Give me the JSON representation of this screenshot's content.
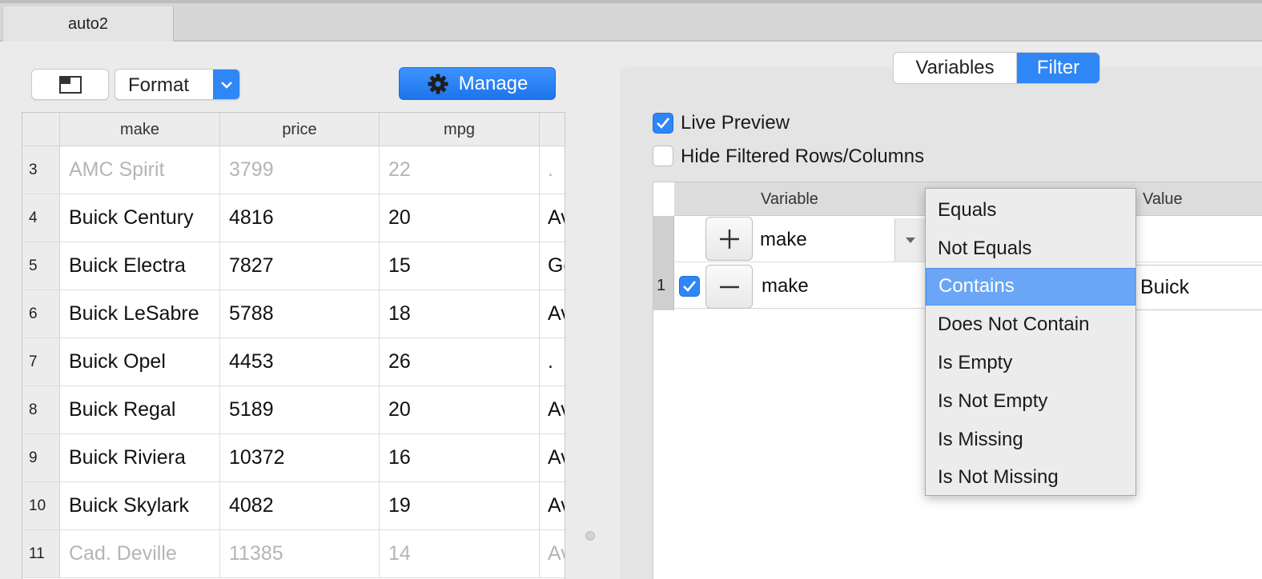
{
  "document_tab": {
    "label": "auto2"
  },
  "toolbar": {
    "format_label": "Format",
    "manage_label": "Manage"
  },
  "grid": {
    "columns": [
      "make",
      "price",
      "mpg",
      ""
    ],
    "rows": [
      {
        "num": "3",
        "make": "AMC Spirit",
        "price": "3799",
        "mpg": "22",
        "extra": ".",
        "dim": true
      },
      {
        "num": "4",
        "make": "Buick Century",
        "price": "4816",
        "mpg": "20",
        "extra": "Av",
        "dim": false
      },
      {
        "num": "5",
        "make": "Buick Electra",
        "price": "7827",
        "mpg": "15",
        "extra": "Go",
        "dim": false
      },
      {
        "num": "6",
        "make": "Buick LeSabre",
        "price": "5788",
        "mpg": "18",
        "extra": "Av",
        "dim": false
      },
      {
        "num": "7",
        "make": "Buick Opel",
        "price": "4453",
        "mpg": "26",
        "extra": ".",
        "dim": false
      },
      {
        "num": "8",
        "make": "Buick Regal",
        "price": "5189",
        "mpg": "20",
        "extra": "Av",
        "dim": false
      },
      {
        "num": "9",
        "make": "Buick Riviera",
        "price": "10372",
        "mpg": "16",
        "extra": "Av",
        "dim": false
      },
      {
        "num": "10",
        "make": "Buick Skylark",
        "price": "4082",
        "mpg": "19",
        "extra": "Av",
        "dim": false
      },
      {
        "num": "11",
        "make": "Cad. Deville",
        "price": "11385",
        "mpg": "14",
        "extra": "Av",
        "dim": true
      }
    ]
  },
  "panel": {
    "tabs": {
      "variables": "Variables",
      "filter": "Filter"
    },
    "live_preview": {
      "label": "Live Preview",
      "checked": true
    },
    "hide_filtered": {
      "label": "Hide Filtered Rows/Columns",
      "checked": false
    },
    "filter_table": {
      "headers": {
        "variable": "Variable",
        "value": "Value"
      },
      "add_row_variable": "make",
      "rule": {
        "index": "1",
        "enabled": true,
        "variable": "make",
        "value": "Buick"
      }
    }
  },
  "operator_menu": {
    "items": [
      "Equals",
      "Not Equals",
      "Contains",
      "Does Not Contain",
      "Is Empty",
      "Is Not Empty",
      "Is Missing",
      "Is Not Missing"
    ],
    "selected": "Contains"
  },
  "colors": {
    "accent": "#2f86f5",
    "menu_highlight": "#6aa6f5"
  },
  "icons": {
    "layout": "window-layout-icon",
    "dropdown": "chevron-down-icon",
    "manage": "gear-icon",
    "add": "plus-icon",
    "remove": "minus-icon",
    "check": "checkmark-icon",
    "combo": "triangle-down-icon"
  }
}
